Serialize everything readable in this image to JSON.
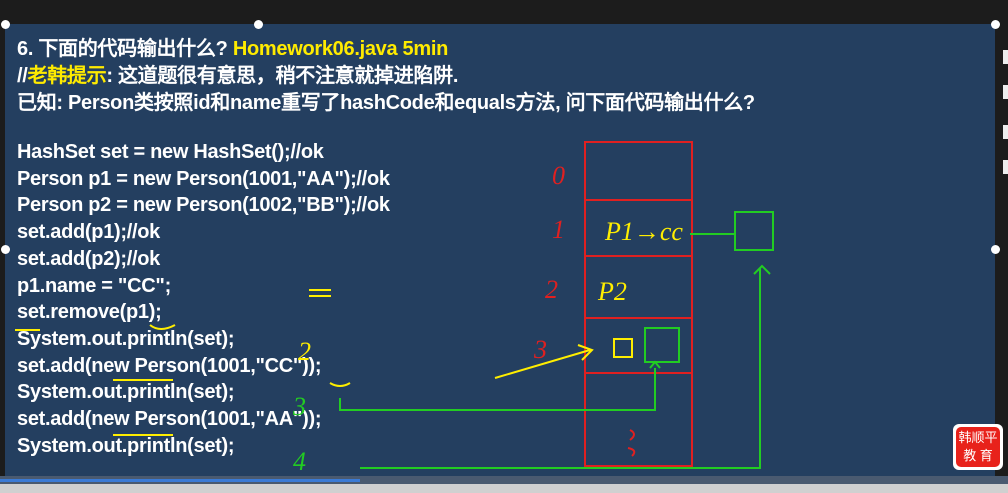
{
  "slide": {
    "title": "6. 下面的代码输出什么?",
    "title_file": "Homework06.java 5min",
    "hint_prefix": "//",
    "hint_label": "老韩提示",
    "hint_text": ":  这道题很有意思，稍不注意就掉进陷阱.",
    "known": "已知: Person类按照id和name重写了hashCode和equals方法, 问下面代码输出什么?",
    "code": [
      "HashSet set = new HashSet();//ok",
      "Person p1 = new Person(1001,\"AA\");//ok",
      "Person p2 = new Person(1002,\"BB\");//ok",
      "set.add(p1);//ok",
      "set.add(p2);//ok",
      "p1.name = \"CC\";",
      "set.remove(p1);",
      "System.out.println(set);",
      "set.add(new Person(1001,\"CC\"));",
      "System.out.println(set);",
      "set.add(new Person(1001,\"AA\"));",
      "System.out.println(set);"
    ],
    "annotations": {
      "idx0": "0",
      "idx1": "1",
      "idx2": "2",
      "idx3": "3",
      "p1cc": "P1→cc",
      "p2": "P2",
      "out1": "2",
      "out2": "3",
      "out3": "4"
    }
  },
  "logo": {
    "line1": "韩顺平",
    "line2": "教  育"
  },
  "colors": {
    "slide_bg": "#243f60",
    "highlight": "#ffeb00",
    "ink_red": "#e02020",
    "ink_green": "#22cc22",
    "ink_yellow": "#ffee00"
  }
}
